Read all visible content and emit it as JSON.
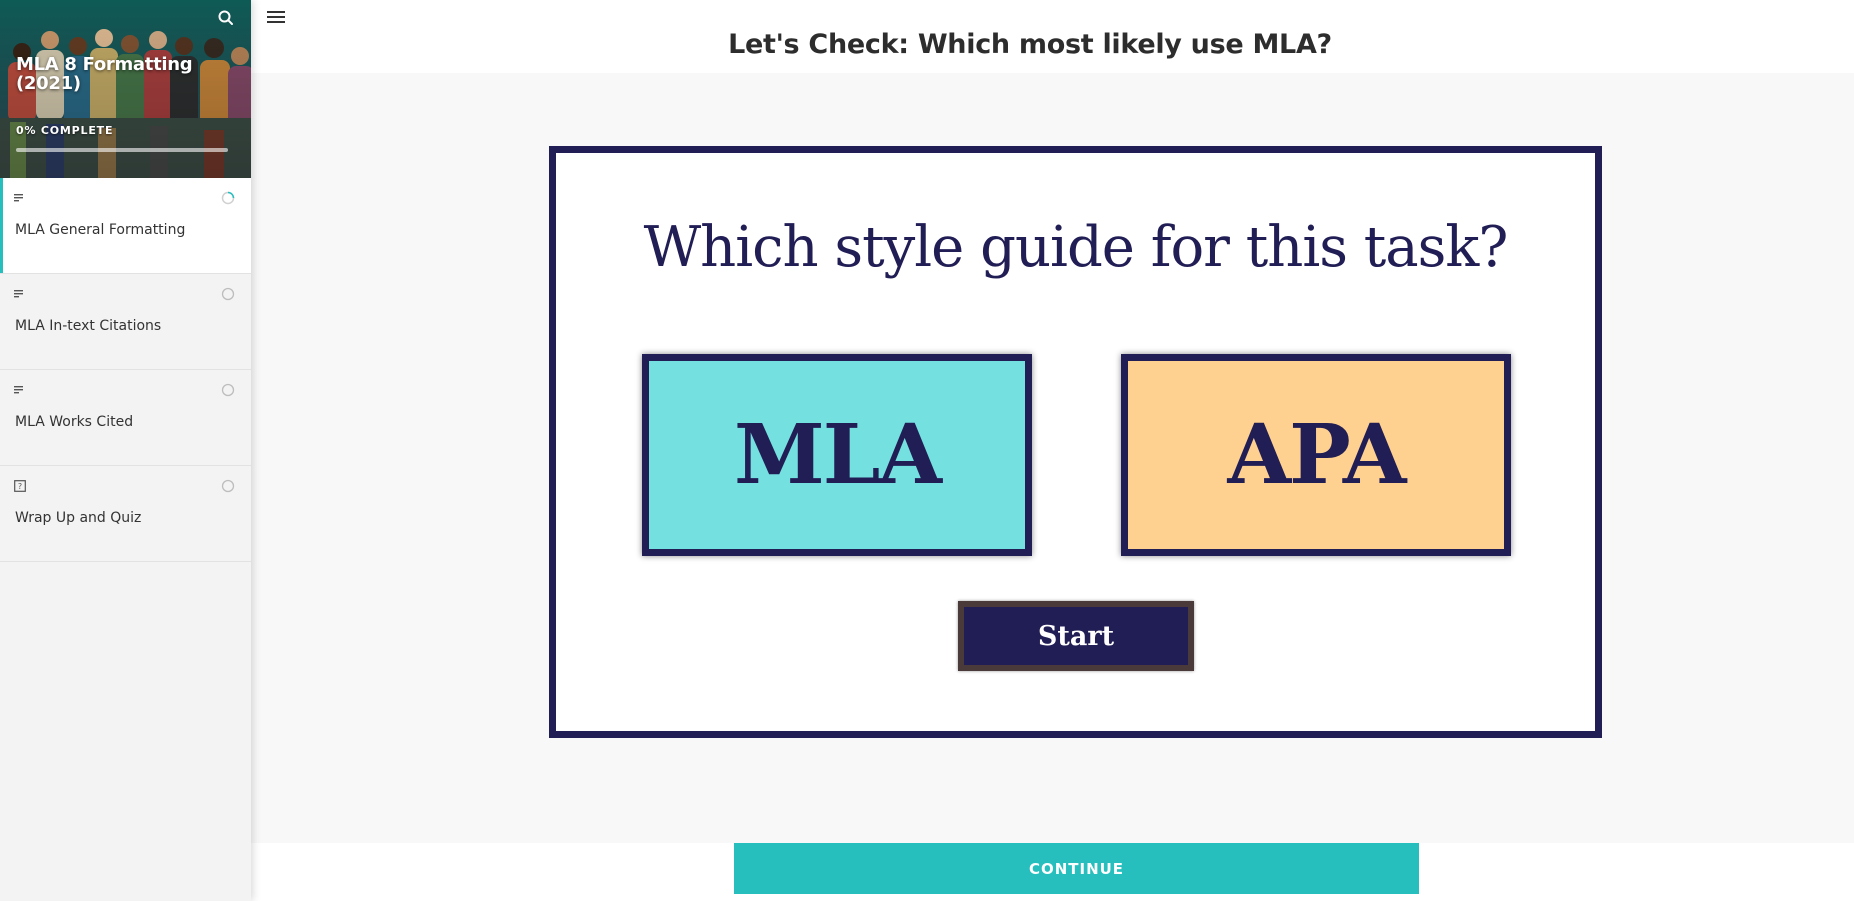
{
  "sidebar": {
    "course_title": "MLA 8 Formatting (2021)",
    "progress_label": "0% COMPLETE",
    "progress": 0,
    "lessons": [
      {
        "label": "MLA General Formatting",
        "type_icon": "text-lines-icon",
        "status": "in-progress"
      },
      {
        "label": "MLA In-text Citations",
        "type_icon": "text-lines-icon",
        "status": "not-started"
      },
      {
        "label": "MLA Works Cited",
        "type_icon": "text-lines-icon",
        "status": "not-started"
      },
      {
        "label": "Wrap Up and Quiz",
        "type_icon": "quiz-icon",
        "status": "not-started"
      }
    ]
  },
  "header": {
    "title": "Let's Check: Which most likely use MLA?"
  },
  "activity": {
    "question": "Which style guide for this task?",
    "choices": [
      "MLA",
      "APA"
    ],
    "start_label": "Start"
  },
  "footer": {
    "continue_label": "CONTINUE"
  },
  "colors": {
    "accent": "#27bebe",
    "navy": "#211d55",
    "mla_card": "#74e0e0",
    "apa_card": "#fed190"
  }
}
